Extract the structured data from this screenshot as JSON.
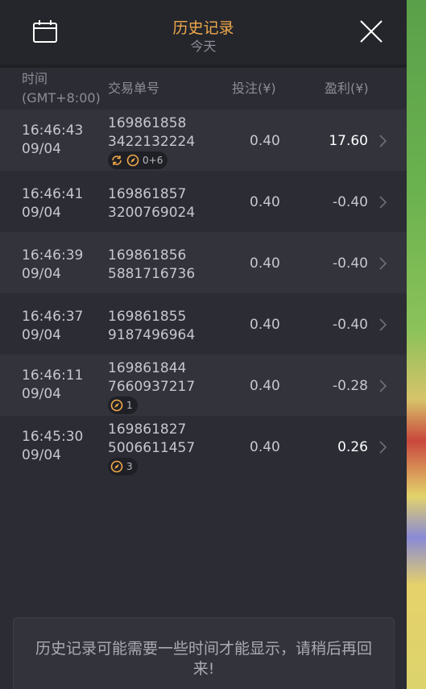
{
  "header": {
    "title": "历史记录",
    "subtitle": "今天",
    "calendar_icon": "calendar-icon",
    "close_icon": "close-icon"
  },
  "columns": {
    "time": "时间",
    "timezone": "(GMT+8:00)",
    "trade_id": "交易单号",
    "bet": "投注(¥)",
    "profit": "盈利(¥)"
  },
  "rows": [
    {
      "time": "16:46:43",
      "date": "09/04",
      "id_line1": "169861858",
      "id_line2": "3422132224",
      "bet": "0.40",
      "profit": "17.60",
      "profit_positive": true,
      "badge": {
        "icons": [
          "refresh-icon",
          "compass-icon"
        ],
        "text": "0+6"
      }
    },
    {
      "time": "16:46:41",
      "date": "09/04",
      "id_line1": "169861857",
      "id_line2": "3200769024",
      "bet": "0.40",
      "profit": "-0.40",
      "profit_positive": false,
      "badge": null
    },
    {
      "time": "16:46:39",
      "date": "09/04",
      "id_line1": "169861856",
      "id_line2": "5881716736",
      "bet": "0.40",
      "profit": "-0.40",
      "profit_positive": false,
      "badge": null
    },
    {
      "time": "16:46:37",
      "date": "09/04",
      "id_line1": "169861855",
      "id_line2": "9187496964",
      "bet": "0.40",
      "profit": "-0.40",
      "profit_positive": false,
      "badge": null
    },
    {
      "time": "16:46:11",
      "date": "09/04",
      "id_line1": "169861844",
      "id_line2": "7660937217",
      "bet": "0.40",
      "profit": "-0.28",
      "profit_positive": false,
      "badge": {
        "icons": [
          "compass-icon"
        ],
        "text": "1"
      }
    },
    {
      "time": "16:45:30",
      "date": "09/04",
      "id_line1": "169861827",
      "id_line2": "5006611457",
      "bet": "0.40",
      "profit": "0.26",
      "profit_positive": true,
      "badge": {
        "icons": [
          "compass-icon"
        ],
        "text": "3"
      }
    }
  ],
  "notice": {
    "message": "历史记录可能需要一些时间才能显示，请稍后再回来!"
  },
  "colors": {
    "accent": "#f0a94a",
    "background": "#2b2c34",
    "row_alt": "#32333b",
    "text": "#c6c7cf",
    "muted": "#8c8d96"
  }
}
